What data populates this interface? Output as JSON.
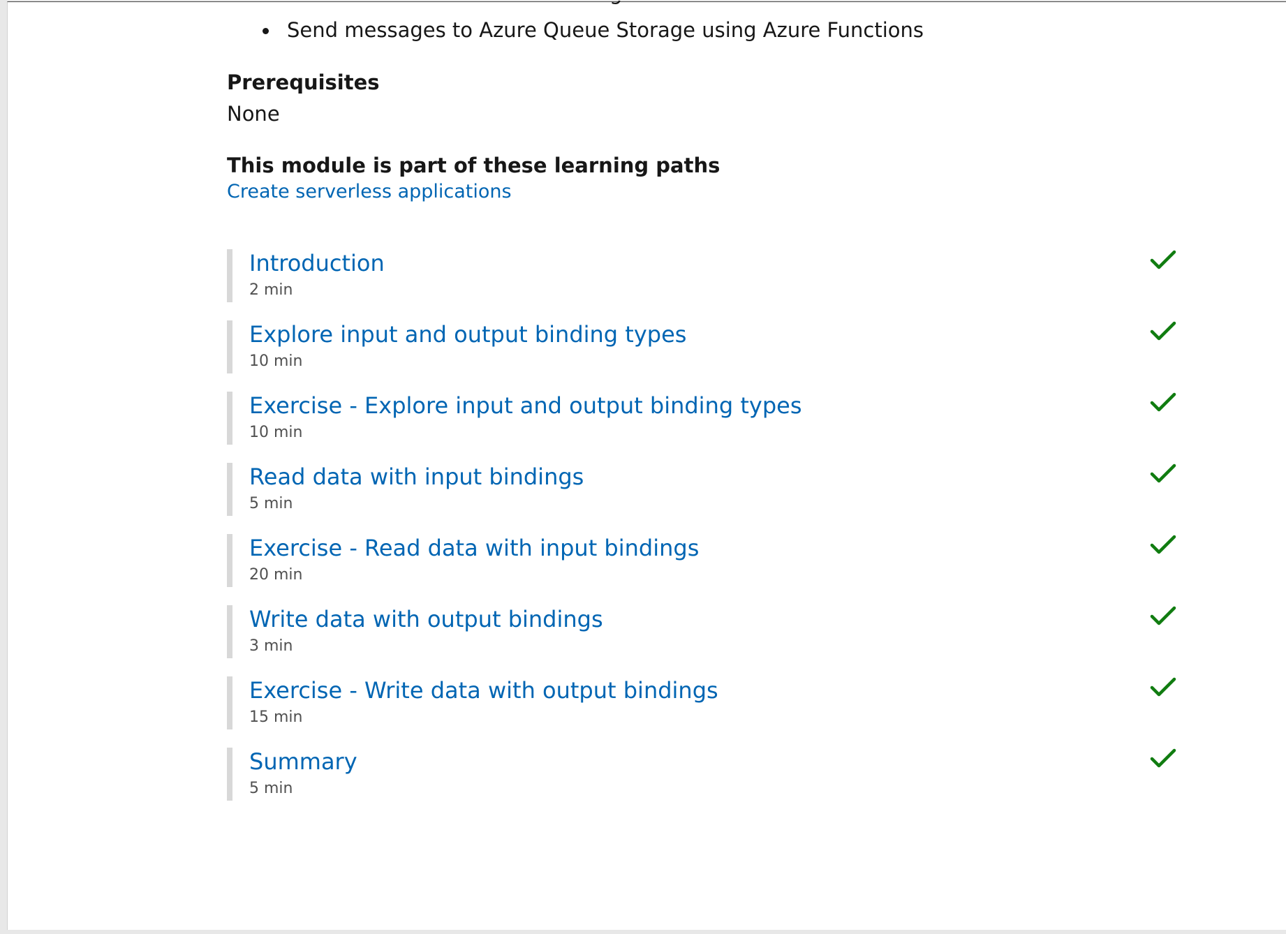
{
  "objectives": {
    "partial_previous_line": "g",
    "items": [
      "Send messages to Azure Queue Storage using Azure Functions"
    ]
  },
  "prerequisites": {
    "heading": "Prerequisites",
    "value": "None"
  },
  "learning_paths": {
    "heading": "This module is part of these learning paths",
    "links": [
      "Create serverless applications"
    ]
  },
  "units": [
    {
      "title": "Introduction",
      "duration": "2 min",
      "completed": true
    },
    {
      "title": "Explore input and output binding types",
      "duration": "10 min",
      "completed": true
    },
    {
      "title": "Exercise - Explore input and output binding types",
      "duration": "10 min",
      "completed": true
    },
    {
      "title": "Read data with input bindings",
      "duration": "5 min",
      "completed": true
    },
    {
      "title": "Exercise - Read data with input bindings",
      "duration": "20 min",
      "completed": true
    },
    {
      "title": "Write data with output bindings",
      "duration": "3 min",
      "completed": true
    },
    {
      "title": "Exercise - Write data with output bindings",
      "duration": "15 min",
      "completed": true
    },
    {
      "title": "Summary",
      "duration": "5 min",
      "completed": true
    }
  ],
  "colors": {
    "link": "#0065b3",
    "check": "#107c10",
    "unit_border": "#d8d8d8"
  },
  "icons": {
    "completed": "check-icon"
  }
}
